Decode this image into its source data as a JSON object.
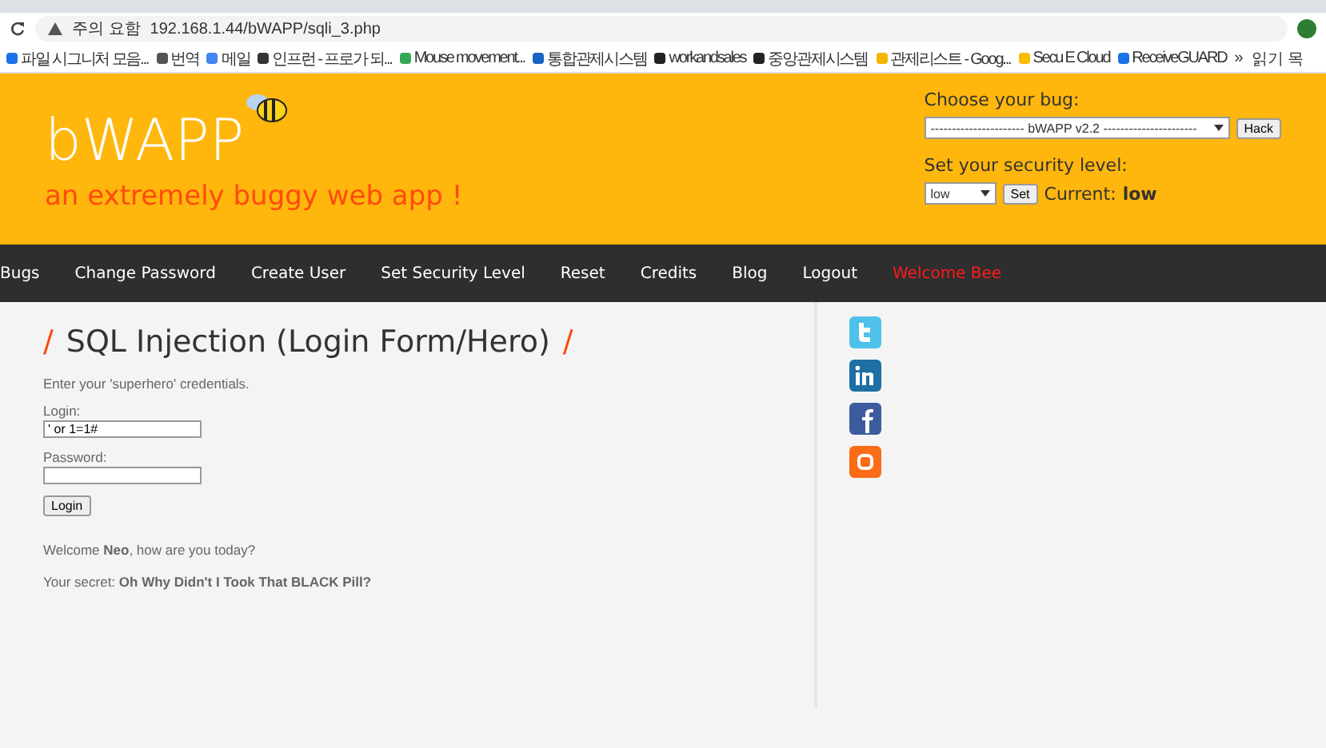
{
  "browser": {
    "warning": "주의 요함",
    "url": "192.168.1.44/bWAPP/sqli_3.php",
    "bookmarks": [
      {
        "label": "파일 시그니처 모음..."
      },
      {
        "label": "번역"
      },
      {
        "label": "메일"
      },
      {
        "label": "인프런 - 프로가 되..."
      },
      {
        "label": "Mouse movement..."
      },
      {
        "label": "통합관제시스템"
      },
      {
        "label": "workandsales"
      },
      {
        "label": "중앙관제시스템"
      },
      {
        "label": "관제리스트 - Goog..."
      },
      {
        "label": "Secu E Cloud"
      },
      {
        "label": "ReceiveGUARD"
      }
    ],
    "more": "»",
    "reading_list": "읽기 목"
  },
  "header": {
    "logo": "bWAPP",
    "tagline": "an extremely buggy web app !",
    "bug_label": "Choose your bug:",
    "bug_select": "---------------------- bWAPP v2.2 ----------------------",
    "hack_button": "Hack",
    "security_label": "Set your security level:",
    "security_select": "low",
    "set_button": "Set",
    "current_label": "Current:",
    "current_value": "low"
  },
  "nav": [
    {
      "label": "Bugs",
      "kind": "link"
    },
    {
      "label": "Change Password",
      "kind": "link"
    },
    {
      "label": "Create User",
      "kind": "link"
    },
    {
      "label": "Set Security Level",
      "kind": "link"
    },
    {
      "label": "Reset",
      "kind": "link"
    },
    {
      "label": "Credits",
      "kind": "link"
    },
    {
      "label": "Blog",
      "kind": "link"
    },
    {
      "label": "Logout",
      "kind": "link"
    },
    {
      "label": "Welcome Bee",
      "kind": "welcome"
    }
  ],
  "content": {
    "slash_left": "/",
    "title": "SQL Injection (Login Form/Hero)",
    "slash_right": "/",
    "intro": "Enter your 'superhero' credentials.",
    "login_label": "Login:",
    "login_value": "' or 1=1#",
    "password_label": "Password:",
    "login_button": "Login",
    "welcome": "Welcome **Neo**, how are you today?",
    "secret": "Your secret: **Oh Why Didn't I Took That BLACK Pill?**"
  },
  "social": [
    {
      "kind": "twitter"
    },
    {
      "kind": "linkedin"
    },
    {
      "kind": "facebook"
    },
    {
      "kind": "blogger"
    }
  ]
}
